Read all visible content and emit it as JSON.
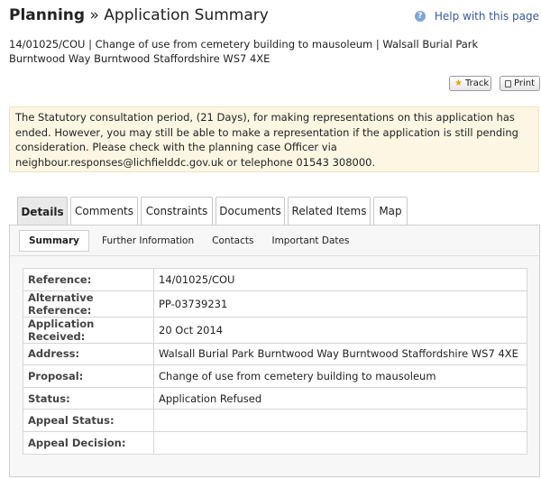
{
  "header": {
    "title_bold": "Planning",
    "title_rest": " » Application Summary",
    "help_label": "Help with this page",
    "help_icon": "question-icon"
  },
  "summary_line": "14/01025/COU | Change of use from cemetery building to mausoleum | Walsall Burial Park Burntwood Way Burntwood Staffordshire WS7 4XE",
  "actions": {
    "track_label": "Track",
    "print_label": "Print"
  },
  "notice": "The Statutory consultation period, (21 Days), for making representations on this application has ended. However, you may still be able to make a representation if the application is still pending consideration. Please check with the planning case Officer via neighbour.responses@lichfielddc.gov.uk or telephone 01543 308000.",
  "tabs": [
    {
      "label": "Details",
      "active": true
    },
    {
      "label": "Comments"
    },
    {
      "label": "Constraints"
    },
    {
      "label": "Documents"
    },
    {
      "label": "Related Items"
    },
    {
      "label": "Map"
    }
  ],
  "subtabs": [
    {
      "label": "Summary",
      "active": true
    },
    {
      "label": "Further Information"
    },
    {
      "label": "Contacts"
    },
    {
      "label": "Important Dates"
    }
  ],
  "details": [
    {
      "label": "Reference:",
      "value": "14/01025/COU"
    },
    {
      "label": "Alternative Reference:",
      "value": "PP-03739231"
    },
    {
      "label": "Application Received:",
      "value": "20 Oct 2014"
    },
    {
      "label": "Address:",
      "value": "Walsall Burial Park Burntwood Way Burntwood Staffordshire WS7 4XE"
    },
    {
      "label": "Proposal:",
      "value": "Change of use from cemetery building to mausoleum"
    },
    {
      "label": "Status:",
      "value": "Application Refused"
    },
    {
      "label": "Appeal Status:",
      "value": ""
    },
    {
      "label": "Appeal Decision:",
      "value": ""
    }
  ]
}
